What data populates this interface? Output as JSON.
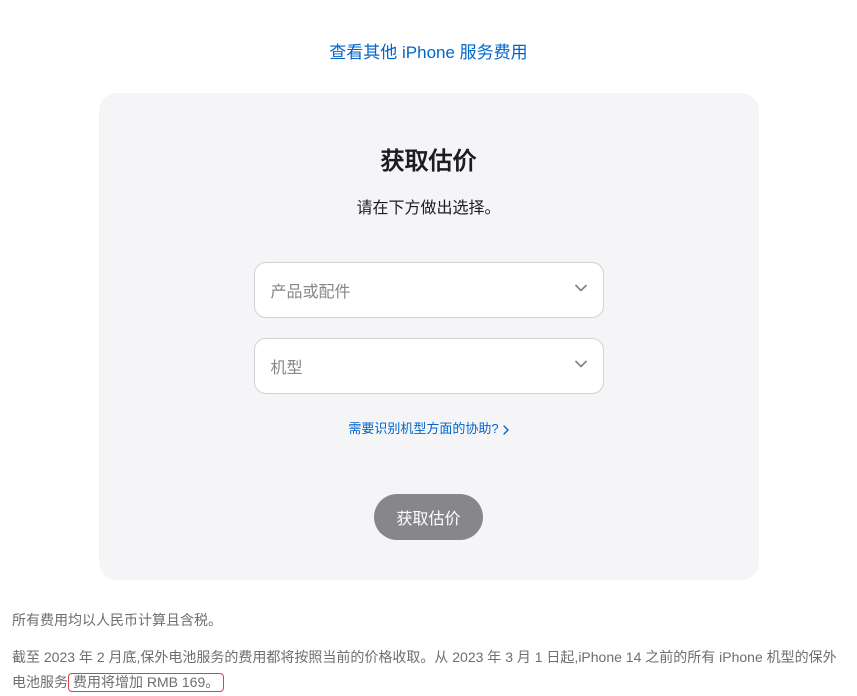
{
  "topLink": {
    "label": "查看其他 iPhone 服务费用"
  },
  "card": {
    "title": "获取估价",
    "subtitle": "请在下方做出选择。",
    "selectProduct": {
      "placeholder": "产品或配件"
    },
    "selectModel": {
      "placeholder": "机型"
    },
    "helpLink": {
      "label": "需要识别机型方面的协助?"
    },
    "button": {
      "label": "获取估价"
    }
  },
  "disclaimer": {
    "line1": "所有费用均以人民币计算且含税。",
    "line2_before": "截至 2023 年 2 月底,保外电池服务的费用都将按照当前的价格收取。从 2023 年 3 月 1 日起,iPhone 14 之前的所有 iPhone 机型的保外电池服务",
    "line2_highlighted": "费用将增加 RMB 169。"
  }
}
